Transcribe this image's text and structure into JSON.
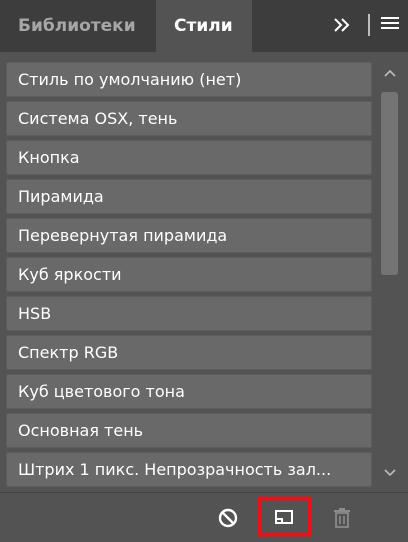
{
  "tabs": {
    "libraries_label": "Библиотеки",
    "styles_label": "Стили"
  },
  "styles_list": {
    "items": [
      "Стиль по умолчанию (нет)",
      "Система OSX, тень",
      "Кнопка",
      "Пирамида",
      "Перевернутая пирамида",
      "Куб яркости",
      "HSB",
      "Спектр RGB",
      "Куб цветового тона",
      "Основная тень",
      "Штрих 1 пикс. Непрозрачность зал..."
    ]
  },
  "footer": {
    "icons": [
      "clear-style-icon",
      "new-style-icon",
      "trash-icon"
    ],
    "highlight_color": "#e8121b"
  },
  "colors": {
    "panel_bg": "#535353",
    "tabbar_bg": "#3d3d3d",
    "item_bg": "#696969",
    "text": "#ffffff"
  }
}
